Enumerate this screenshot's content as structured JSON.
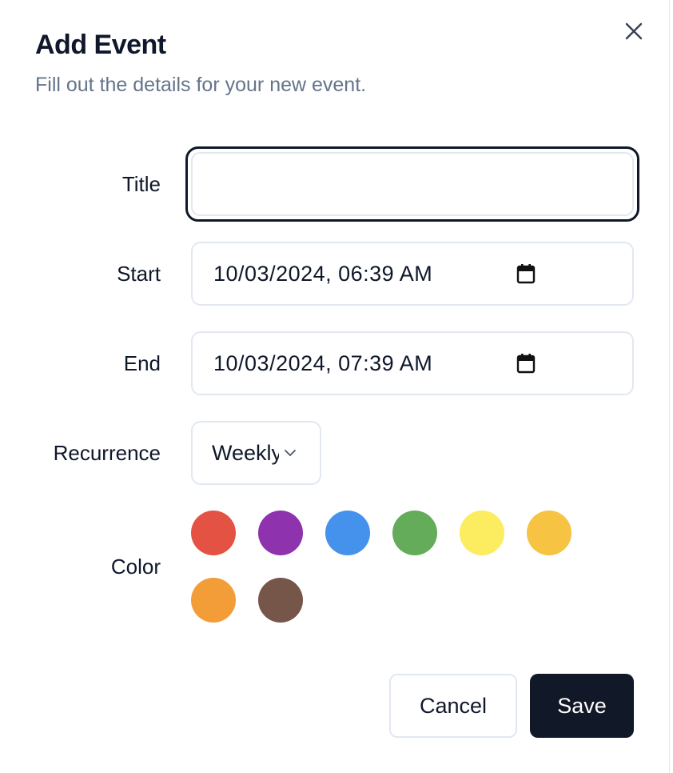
{
  "dialog": {
    "title": "Add Event",
    "subtitle": "Fill out the details for your new event."
  },
  "form": {
    "title_label": "Title",
    "title_value": "",
    "start_label": "Start",
    "start_value": "10/03/2024, 06:39 AM",
    "end_label": "End",
    "end_value": "10/03/2024, 07:39 AM",
    "recurrence_label": "Recurrence",
    "recurrence_value": "Weekly",
    "color_label": "Color",
    "colors": [
      "#e35243",
      "#8e32ad",
      "#4592ec",
      "#64ab5a",
      "#fcec5f",
      "#f6c343",
      "#f29d38",
      "#77564a"
    ]
  },
  "actions": {
    "cancel_label": "Cancel",
    "save_label": "Save"
  },
  "icons": {
    "close": "close-icon",
    "calendar": "calendar-icon",
    "chevron": "chevron-down-icon"
  }
}
